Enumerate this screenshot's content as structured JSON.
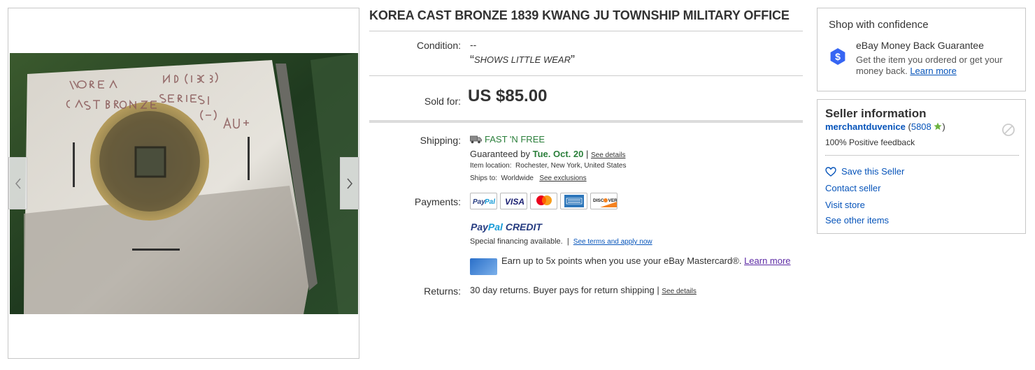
{
  "gallery": {
    "photo_alt": "Coin in cardboard holder",
    "holder_text": [
      "KOREA",
      "ND (1839)",
      "CAST BRONZE SERIES I",
      "(--)",
      "AU+"
    ],
    "prev_icon": "chevron-left-icon",
    "next_icon": "chevron-right-icon"
  },
  "listing": {
    "title": "KOREA CAST BRONZE 1839 KWANG JU TOWNSHIP MILITARY OFFICE",
    "condition_label": "Condition:",
    "condition_value": "--",
    "condition_quote": "SHOWS LITTLE WEAR",
    "sold_label": "Sold for:",
    "price": "US $85.00"
  },
  "shipping": {
    "label": "Shipping:",
    "method": "FAST 'N FREE",
    "guaranteed_prefix": "Guaranteed by",
    "guaranteed_date": "Tue. Oct. 20",
    "see_details": "See details",
    "item_location_label": "Item location:",
    "item_location": "Rochester, New York, United States",
    "ships_to_label": "Ships to:",
    "ships_to": "Worldwide",
    "see_exclusions": "See exclusions"
  },
  "payments": {
    "label": "Payments:",
    "cards": [
      {
        "name": "PayPal",
        "icon": "paypal-logo-icon"
      },
      {
        "name": "VISA",
        "icon": "visa-logo-icon"
      },
      {
        "name": "Mastercard",
        "icon": "mastercard-logo-icon"
      },
      {
        "name": "American Express",
        "icon": "amex-logo-icon"
      },
      {
        "name": "DISCOVER",
        "icon": "discover-logo-icon"
      }
    ],
    "paypal_credit_1": "Pay",
    "paypal_credit_2": "Pal",
    "paypal_credit_3": " CREDIT",
    "financing_text": "Special financing available.",
    "financing_link": "See terms and apply now",
    "mastercard_text": "Earn up to 5x points when you use your eBay Mastercard®.",
    "mastercard_link": "Learn more"
  },
  "returns": {
    "label": "Returns:",
    "value": "30 day returns. Buyer pays for return shipping",
    "see_details": "See details"
  },
  "confidence": {
    "title": "Shop with confidence",
    "guarantee_title": "eBay Money Back Guarantee",
    "guarantee_desc": "Get the item you ordered or get your money back.",
    "learn_more": "Learn more"
  },
  "seller": {
    "title": "Seller information",
    "name": "merchantduvenice",
    "feedback_count": "5808",
    "positive": "100% Positive feedback",
    "save": "Save this Seller",
    "contact": "Contact seller",
    "visit": "Visit store",
    "other": "See other items"
  },
  "colors": {
    "link_blue": "#0654ba",
    "free_green": "#2b7f3b",
    "star_green": "#6cb33f",
    "purple_link": "#5e2ca5",
    "shield_blue": "#3665f3"
  }
}
